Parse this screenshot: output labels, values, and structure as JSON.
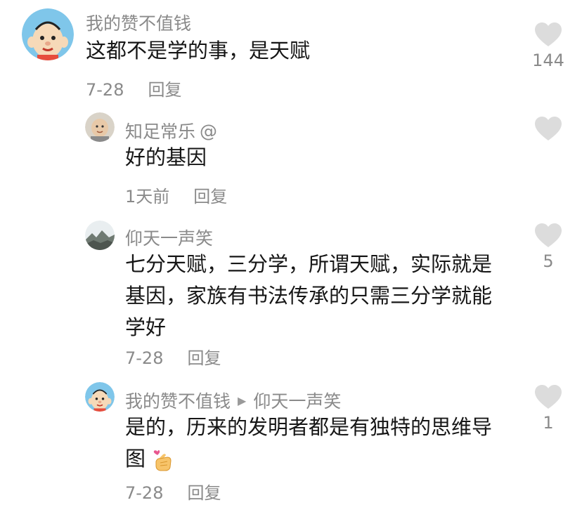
{
  "comments": [
    {
      "author": "我的赞不值钱",
      "text": "这都不是学的事，是天赋",
      "date": "7-28",
      "reply_label": "回复",
      "likes": "144",
      "avatar": "cartoon-boy-avatar"
    },
    {
      "author": "知足常乐",
      "author_suffix": "@",
      "text": "好的基因",
      "date": "1天前",
      "reply_label": "回复",
      "likes": "",
      "avatar": "baby-photo-avatar"
    },
    {
      "author": "仰天一声笑",
      "text_lines": [
        "七分天赋，三分学，所谓天赋，实际就是",
        "基因，家族有书法传承的只需三分学就能",
        "学好"
      ],
      "date": "7-28",
      "reply_label": "回复",
      "likes": "5",
      "avatar": "landscape-photo-avatar"
    },
    {
      "author": "我的赞不值钱",
      "reply_to": "仰天一声笑",
      "text_lines": [
        "是的，历来的发明者都是有独特的思维导",
        "图"
      ],
      "emoji": "finger-heart-emoji",
      "date": "7-28",
      "reply_label": "回复",
      "likes": "1",
      "avatar": "cartoon-boy-avatar"
    }
  ],
  "colors": {
    "text": "#161616",
    "secondary": "#8a8a8a",
    "heart": "#dcdcdc"
  }
}
